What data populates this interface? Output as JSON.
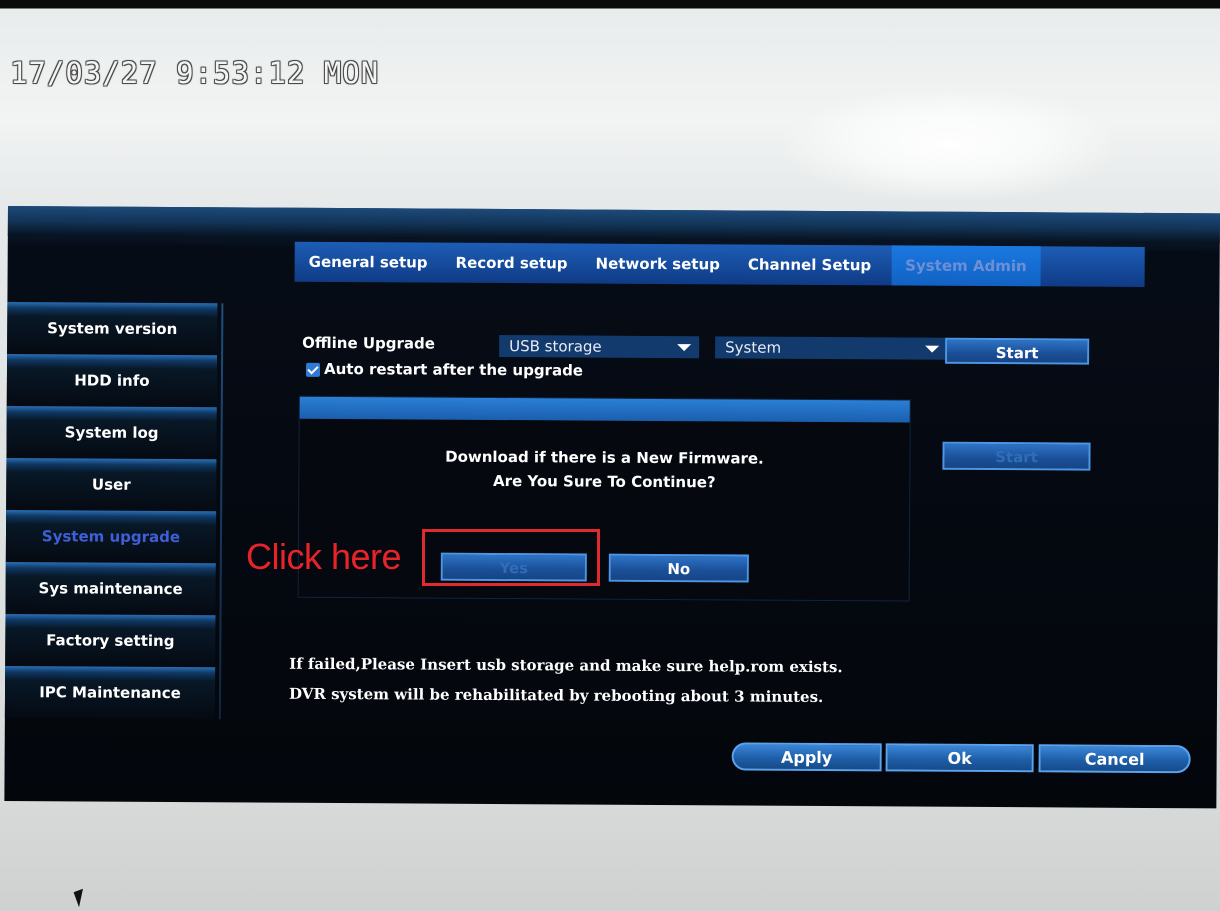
{
  "clock": "17/03/27 9:53:12 MON",
  "tabs": [
    {
      "label": "General setup"
    },
    {
      "label": "Record setup"
    },
    {
      "label": "Network setup"
    },
    {
      "label": "Channel Setup"
    },
    {
      "label": "System Admin",
      "active": true
    }
  ],
  "sidebar": {
    "items": [
      {
        "label": "System version"
      },
      {
        "label": "HDD info"
      },
      {
        "label": "System log"
      },
      {
        "label": "User"
      },
      {
        "label": "System upgrade",
        "active": true
      },
      {
        "label": "Sys maintenance"
      },
      {
        "label": "Factory setting"
      },
      {
        "label": "IPC Maintenance"
      }
    ]
  },
  "upgrade": {
    "label": "Offline Upgrade",
    "source_select": "USB storage",
    "type_select": "System",
    "start_label": "Start",
    "auto_restart_label": "Auto restart after the upgrade",
    "auto_restart_checked": true,
    "online_start_label": "Start"
  },
  "dialog": {
    "line1": "Download if there is a New Firmware.",
    "line2": "Are You Sure To Continue?",
    "yes_label": "Yes",
    "no_label": "No"
  },
  "notes": {
    "line1": "If failed,Please Insert usb storage and make sure help.rom exists.",
    "line2": "DVR system will be rehabilitated by rebooting about 3 minutes."
  },
  "footer": {
    "apply_label": "Apply",
    "ok_label": "Ok",
    "cancel_label": "Cancel"
  },
  "annotation": {
    "text": "Click here",
    "color": "#e8232a"
  },
  "colors": {
    "accent": "#1d5db6",
    "active_text": "#3e5fd8"
  }
}
